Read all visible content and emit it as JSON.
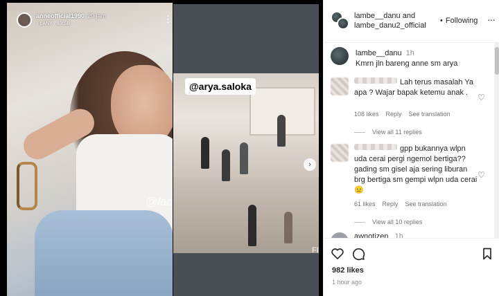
{
  "story": {
    "username": "anneofficial1990",
    "time": "20 jam",
    "music": "LANY · ILYSB",
    "watermark": "@lambe__danu"
  },
  "second_story": {
    "tag": "@arya.saloka",
    "watermark": "FIL"
  },
  "header": {
    "account_1": "lambe__danu",
    "joiner": "and",
    "account_2": "lambe_danu2_official",
    "follow_label": "Following",
    "more_icon": "more-horizontal-icon"
  },
  "caption": {
    "username": "lambe__danu",
    "time": "1h",
    "text": "Kmrn jln bareng anne sm arya"
  },
  "comments": [
    {
      "text": "Lah terus masalah Ya apa ? Wajar bapak ketemu anak .",
      "likes": "108 likes",
      "reply_label": "Reply",
      "translate_label": "See translation",
      "view_replies": "View all 11 replies"
    },
    {
      "text": "gpp bukannya wlpn uda cerai pergi ngemol bertiga?? gading sm gisel aja sering liburan brg bertiga sm gempi wlpn uda cerai 😑",
      "likes": "61 likes",
      "reply_label": "Reply",
      "translate_label": "See translation",
      "view_replies": "View all 10 replies"
    },
    {
      "username": "awnotizen",
      "time": "1h"
    }
  ],
  "footer": {
    "likes": "982 likes",
    "time_ago": "1 hour ago"
  },
  "colors": {
    "text": "#262626",
    "secondary": "#737373",
    "border": "#efefef"
  }
}
